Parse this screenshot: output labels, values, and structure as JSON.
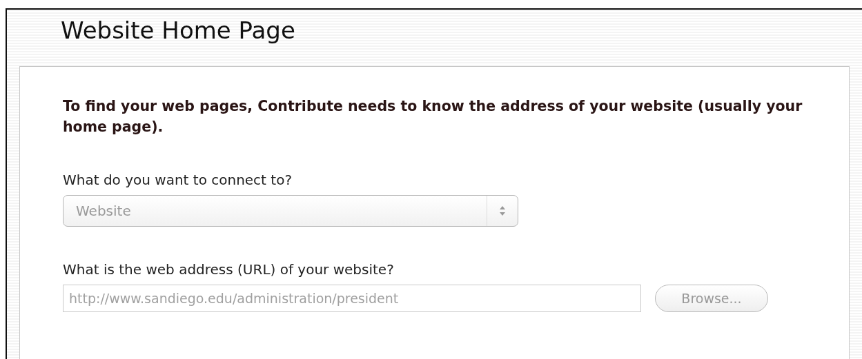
{
  "page": {
    "title": "Website Home Page"
  },
  "intro": "To find your web pages, Contribute needs to know the address of your website (usually your home page).",
  "connection": {
    "label": "What do you want to connect to?",
    "value": "Website",
    "disabled": true
  },
  "address": {
    "label": "What is the web address (URL) of your website?",
    "value": "http://www.sandiego.edu/administration/president",
    "disabled": true
  },
  "browse_button": {
    "label": "Browse...",
    "disabled": true
  }
}
